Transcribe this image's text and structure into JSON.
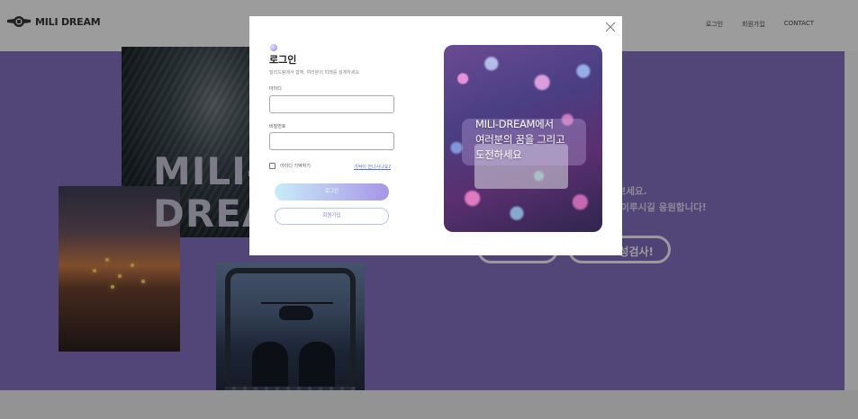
{
  "header": {
    "logo_text": "MILI DREAM",
    "nav": [
      {
        "label": "로그인"
      },
      {
        "label": "회원가입"
      },
      {
        "label": "CONTACT"
      }
    ]
  },
  "hero": {
    "title_line1": "MILI-",
    "title_line2": "DREA",
    "copy_line1": "해보세요.",
    "copy_line2": "을 이루시길 응원합니다!",
    "button1_label": "",
    "button2_label": "성검사!",
    "background_color": "#806ebc"
  },
  "modal": {
    "title": "로그인",
    "subtitle": "밀리드림에서 함께, 여러분의 미래를 설계하세요",
    "id_label": "아이디",
    "id_value": "",
    "password_label": "비밀번호",
    "password_value": "",
    "remember_label": "아이디 기억하기",
    "forgot_link": "기억이 안나시나요?",
    "login_button": "로그인",
    "join_button": "회원가입",
    "promo_text": "MILI-DREAM에서\n여러분의 꿈을 그리고\n도전하세요",
    "close_icon": "close-icon"
  }
}
